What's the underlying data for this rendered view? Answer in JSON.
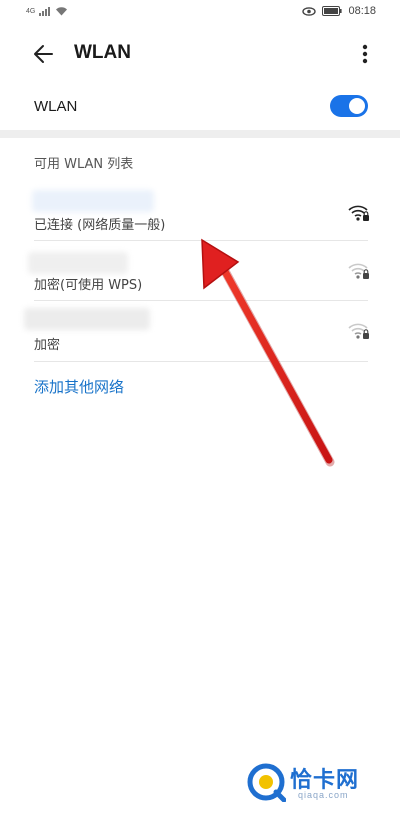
{
  "status_bar": {
    "network_type": "4G",
    "time": "08:18"
  },
  "header": {
    "title": "WLAN",
    "back_icon": "arrow-left-icon",
    "more_icon": "more-vertical-icon"
  },
  "wlan_toggle": {
    "label": "WLAN",
    "on": true
  },
  "section": {
    "title": "可用 WLAN 列表"
  },
  "networks": [
    {
      "status": "已连接 (网络质量一般)",
      "signal_icon": "wifi-lock-icon",
      "connected": true
    },
    {
      "status": "加密(可使用 WPS)",
      "signal_icon": "wifi-lock-icon",
      "connected": false
    },
    {
      "status": "加密",
      "signal_icon": "wifi-lock-icon",
      "connected": false
    }
  ],
  "add_network": {
    "label": "添加其他网络"
  },
  "colors": {
    "accent": "#1a73e8",
    "link": "#1873c9",
    "annotation_arrow": "#e02020"
  },
  "watermark": {
    "text": "恰卡网",
    "sub": "qiaqa.com"
  }
}
